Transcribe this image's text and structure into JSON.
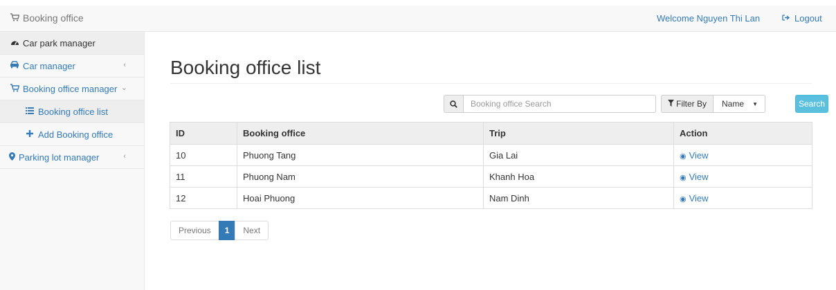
{
  "header": {
    "brand": "Booking office",
    "welcome": "Welcome Nguyen Thi Lan",
    "logout": "Logout"
  },
  "sidebar": {
    "items": [
      {
        "label": "Car park manager",
        "icon": "dashboard-icon"
      },
      {
        "label": "Car manager",
        "icon": "car-icon"
      },
      {
        "label": "Booking office manager",
        "icon": "cart-icon"
      },
      {
        "label": "Booking office list",
        "icon": "list-icon"
      },
      {
        "label": "Add Booking office",
        "icon": "plus-icon"
      },
      {
        "label": "Parking lot manager",
        "icon": "map-marker-icon"
      }
    ]
  },
  "main": {
    "title": "Booking office list",
    "search_placeholder": "Booking office Search",
    "filter_label": "Filter By",
    "filter_value": "Name",
    "search_button": "Search",
    "table": {
      "headers": [
        "ID",
        "Booking office",
        "Trip",
        "Action"
      ],
      "rows": [
        {
          "id": "10",
          "office": "Phuong Tang",
          "trip": "Gia Lai",
          "action": "View"
        },
        {
          "id": "11",
          "office": "Phuong Nam",
          "trip": "Khanh Hoa",
          "action": "View"
        },
        {
          "id": "12",
          "office": "Hoai Phuong",
          "trip": "Nam Dinh",
          "action": "View"
        }
      ]
    },
    "pagination": {
      "previous": "Previous",
      "current": "1",
      "next": "Next"
    }
  },
  "colors": {
    "accent": "#337ab7",
    "search_button": "#5bc0de"
  }
}
